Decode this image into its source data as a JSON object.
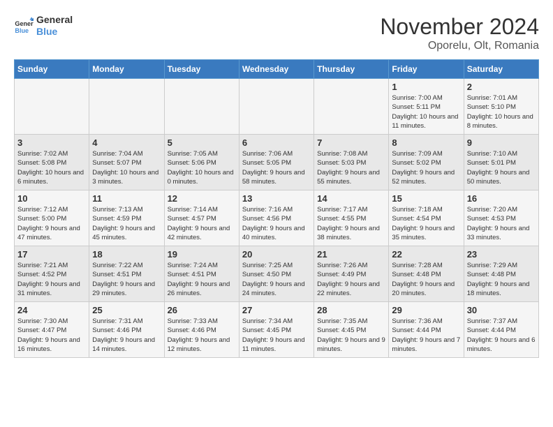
{
  "header": {
    "logo_general": "General",
    "logo_blue": "Blue",
    "month_title": "November 2024",
    "location": "Oporelu, Olt, Romania"
  },
  "days_of_week": [
    "Sunday",
    "Monday",
    "Tuesday",
    "Wednesday",
    "Thursday",
    "Friday",
    "Saturday"
  ],
  "weeks": [
    [
      {
        "day": "",
        "info": ""
      },
      {
        "day": "",
        "info": ""
      },
      {
        "day": "",
        "info": ""
      },
      {
        "day": "",
        "info": ""
      },
      {
        "day": "",
        "info": ""
      },
      {
        "day": "1",
        "info": "Sunrise: 7:00 AM\nSunset: 5:11 PM\nDaylight: 10 hours and 11 minutes."
      },
      {
        "day": "2",
        "info": "Sunrise: 7:01 AM\nSunset: 5:10 PM\nDaylight: 10 hours and 8 minutes."
      }
    ],
    [
      {
        "day": "3",
        "info": "Sunrise: 7:02 AM\nSunset: 5:08 PM\nDaylight: 10 hours and 6 minutes."
      },
      {
        "day": "4",
        "info": "Sunrise: 7:04 AM\nSunset: 5:07 PM\nDaylight: 10 hours and 3 minutes."
      },
      {
        "day": "5",
        "info": "Sunrise: 7:05 AM\nSunset: 5:06 PM\nDaylight: 10 hours and 0 minutes."
      },
      {
        "day": "6",
        "info": "Sunrise: 7:06 AM\nSunset: 5:05 PM\nDaylight: 9 hours and 58 minutes."
      },
      {
        "day": "7",
        "info": "Sunrise: 7:08 AM\nSunset: 5:03 PM\nDaylight: 9 hours and 55 minutes."
      },
      {
        "day": "8",
        "info": "Sunrise: 7:09 AM\nSunset: 5:02 PM\nDaylight: 9 hours and 52 minutes."
      },
      {
        "day": "9",
        "info": "Sunrise: 7:10 AM\nSunset: 5:01 PM\nDaylight: 9 hours and 50 minutes."
      }
    ],
    [
      {
        "day": "10",
        "info": "Sunrise: 7:12 AM\nSunset: 5:00 PM\nDaylight: 9 hours and 47 minutes."
      },
      {
        "day": "11",
        "info": "Sunrise: 7:13 AM\nSunset: 4:59 PM\nDaylight: 9 hours and 45 minutes."
      },
      {
        "day": "12",
        "info": "Sunrise: 7:14 AM\nSunset: 4:57 PM\nDaylight: 9 hours and 42 minutes."
      },
      {
        "day": "13",
        "info": "Sunrise: 7:16 AM\nSunset: 4:56 PM\nDaylight: 9 hours and 40 minutes."
      },
      {
        "day": "14",
        "info": "Sunrise: 7:17 AM\nSunset: 4:55 PM\nDaylight: 9 hours and 38 minutes."
      },
      {
        "day": "15",
        "info": "Sunrise: 7:18 AM\nSunset: 4:54 PM\nDaylight: 9 hours and 35 minutes."
      },
      {
        "day": "16",
        "info": "Sunrise: 7:20 AM\nSunset: 4:53 PM\nDaylight: 9 hours and 33 minutes."
      }
    ],
    [
      {
        "day": "17",
        "info": "Sunrise: 7:21 AM\nSunset: 4:52 PM\nDaylight: 9 hours and 31 minutes."
      },
      {
        "day": "18",
        "info": "Sunrise: 7:22 AM\nSunset: 4:51 PM\nDaylight: 9 hours and 29 minutes."
      },
      {
        "day": "19",
        "info": "Sunrise: 7:24 AM\nSunset: 4:51 PM\nDaylight: 9 hours and 26 minutes."
      },
      {
        "day": "20",
        "info": "Sunrise: 7:25 AM\nSunset: 4:50 PM\nDaylight: 9 hours and 24 minutes."
      },
      {
        "day": "21",
        "info": "Sunrise: 7:26 AM\nSunset: 4:49 PM\nDaylight: 9 hours and 22 minutes."
      },
      {
        "day": "22",
        "info": "Sunrise: 7:28 AM\nSunset: 4:48 PM\nDaylight: 9 hours and 20 minutes."
      },
      {
        "day": "23",
        "info": "Sunrise: 7:29 AM\nSunset: 4:48 PM\nDaylight: 9 hours and 18 minutes."
      }
    ],
    [
      {
        "day": "24",
        "info": "Sunrise: 7:30 AM\nSunset: 4:47 PM\nDaylight: 9 hours and 16 minutes."
      },
      {
        "day": "25",
        "info": "Sunrise: 7:31 AM\nSunset: 4:46 PM\nDaylight: 9 hours and 14 minutes."
      },
      {
        "day": "26",
        "info": "Sunrise: 7:33 AM\nSunset: 4:46 PM\nDaylight: 9 hours and 12 minutes."
      },
      {
        "day": "27",
        "info": "Sunrise: 7:34 AM\nSunset: 4:45 PM\nDaylight: 9 hours and 11 minutes."
      },
      {
        "day": "28",
        "info": "Sunrise: 7:35 AM\nSunset: 4:45 PM\nDaylight: 9 hours and 9 minutes."
      },
      {
        "day": "29",
        "info": "Sunrise: 7:36 AM\nSunset: 4:44 PM\nDaylight: 9 hours and 7 minutes."
      },
      {
        "day": "30",
        "info": "Sunrise: 7:37 AM\nSunset: 4:44 PM\nDaylight: 9 hours and 6 minutes."
      }
    ]
  ]
}
